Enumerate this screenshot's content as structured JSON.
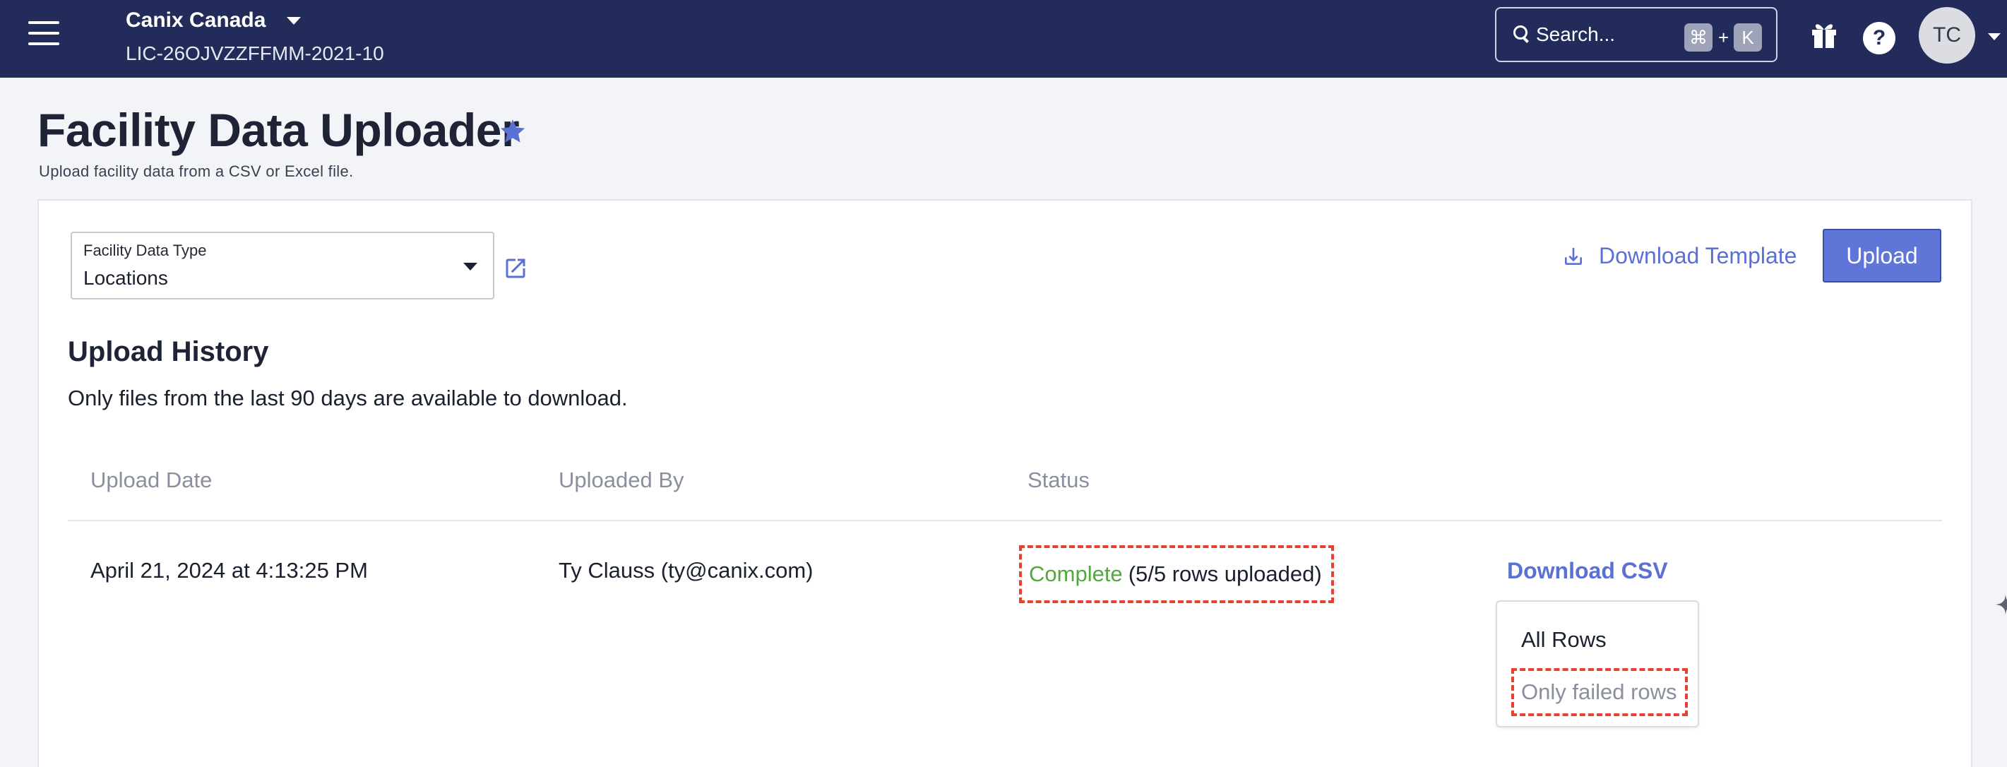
{
  "topbar": {
    "org_name": "Canix Canada",
    "license": "LIC-26OJVZZFFMM-2021-10",
    "search": {
      "placeholder": "Search...",
      "shortcut_modifier": "⌘",
      "shortcut_plus": "+",
      "shortcut_key": "K"
    },
    "help_label": "?",
    "avatar_initials": "TC",
    "icons": [
      "menu-icon",
      "chevron-down-icon",
      "search-icon",
      "gift-icon",
      "help-icon",
      "chevron-down-icon"
    ]
  },
  "page": {
    "title": "Facility Data Uploader",
    "subtitle": "Upload facility data from a CSV or Excel file.",
    "favorite_icon": "star-icon"
  },
  "form": {
    "type_label": "Facility Data Type",
    "type_value": "Locations",
    "external_link_icon": "external-link-icon",
    "download_template_label": "Download Template",
    "upload_label": "Upload"
  },
  "history": {
    "title": "Upload History",
    "note": "Only files from the last 90 days are available to download.",
    "columns": [
      "Upload Date",
      "Uploaded By",
      "Status"
    ],
    "rows": [
      {
        "date": "April 21, 2024 at 4:13:25 PM",
        "uploaded_by": "Ty Clauss (ty@canix.com)",
        "status": "Complete",
        "status_detail": "(5/5 rows uploaded)",
        "download_label": "Download CSV"
      }
    ],
    "download_menu": [
      "All Rows",
      "Only failed rows"
    ]
  },
  "colors": {
    "topbar": "#222b59",
    "accent": "#5f76d8",
    "success": "#52a83e",
    "highlight": "#e8412f"
  }
}
